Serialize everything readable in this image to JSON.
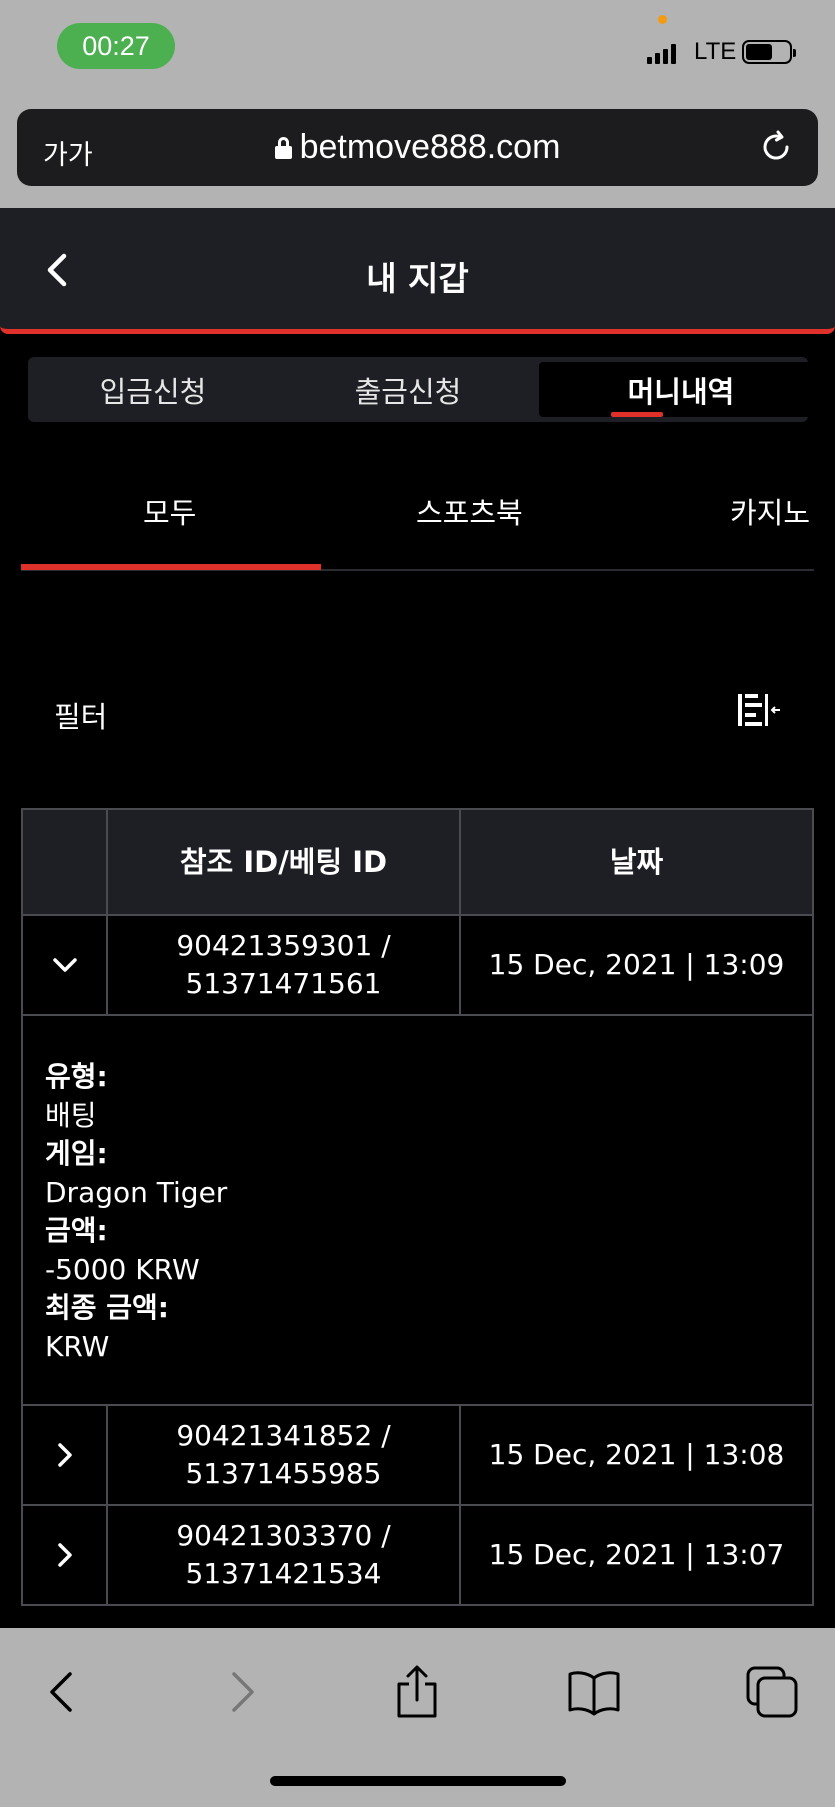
{
  "status_bar": {
    "time": "00:27",
    "network": "LTE"
  },
  "browser": {
    "text_size_label": "가가",
    "url": "betmove888.com"
  },
  "header": {
    "title": "내 지갑"
  },
  "segments": [
    {
      "label": "입금신청",
      "active": false
    },
    {
      "label": "출금신청",
      "active": false
    },
    {
      "label": "머니내역",
      "active": true
    }
  ],
  "category_tabs": [
    {
      "label": "모두",
      "active": true
    },
    {
      "label": "스포츠북",
      "active": false
    },
    {
      "label": "카지노",
      "active": false
    }
  ],
  "filter": {
    "label": "필터"
  },
  "table": {
    "columns": [
      "참조 ID/베팅 ID",
      "날짜"
    ],
    "rows": [
      {
        "ref_id": "90421359301 /",
        "bet_id": "51371471561",
        "date": "15 Dec, 2021 | 13:09",
        "expanded": true
      },
      {
        "ref_id": "90421341852 /",
        "bet_id": "51371455985",
        "date": "15 Dec, 2021 | 13:08",
        "expanded": false
      },
      {
        "ref_id": "90421303370 /",
        "bet_id": "51371421534",
        "date": "15 Dec, 2021 | 13:07",
        "expanded": false
      }
    ],
    "detail": {
      "type_label": "유형:",
      "type_value": "배팅",
      "game_label": "게임:",
      "game_value": "Dragon Tiger",
      "amount_label": "금액:",
      "amount_value": "-5000 KRW",
      "final_label": "최종 금액:",
      "final_value": "KRW"
    }
  },
  "colors": {
    "accent": "#e0302a",
    "panel": "#1e1f24",
    "background": "#000000",
    "chrome": "#b3b3b3"
  }
}
